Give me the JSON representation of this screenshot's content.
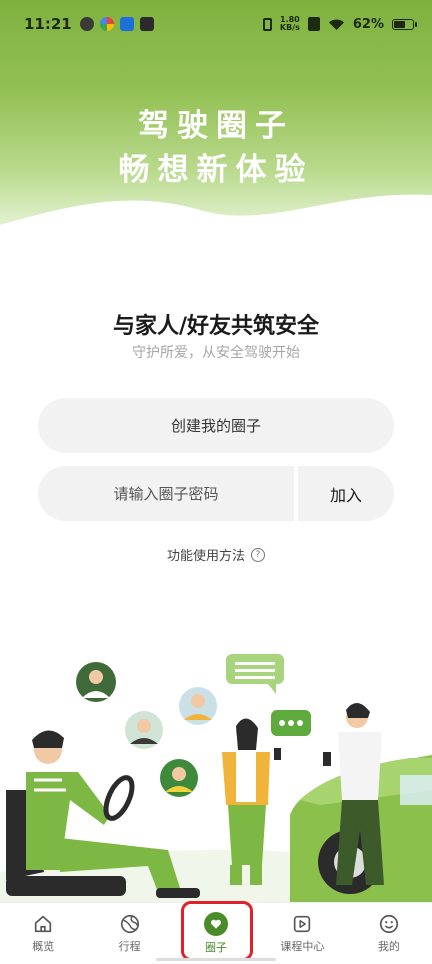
{
  "status_bar": {
    "time": "11:21",
    "speed_value": "1.80",
    "speed_unit": "KB/s",
    "battery_pct": "62%",
    "battery_level": 0.62
  },
  "hero": {
    "line1": "驾驶圈子",
    "line2": "畅想新体验"
  },
  "intro": {
    "headline": "与家人/好友共筑安全",
    "subline": "守护所爱，从安全驾驶开始"
  },
  "actions": {
    "create_label": "创建我的圈子",
    "code_placeholder": "请输入圈子密码",
    "join_label": "加入",
    "howto_label": "功能使用方法",
    "help_glyph": "?"
  },
  "nav": {
    "items": [
      {
        "label": "概览",
        "icon": "home-icon"
      },
      {
        "label": "行程",
        "icon": "globe-icon"
      },
      {
        "label": "圈子",
        "icon": "heart-icon",
        "active": true
      },
      {
        "label": "课程中心",
        "icon": "play-icon"
      },
      {
        "label": "我的",
        "icon": "smile-icon"
      }
    ]
  },
  "colors": {
    "brand_green": "#4a8c2a",
    "hero_green": "#8dbb4c",
    "highlight_red": "#e0202a"
  }
}
